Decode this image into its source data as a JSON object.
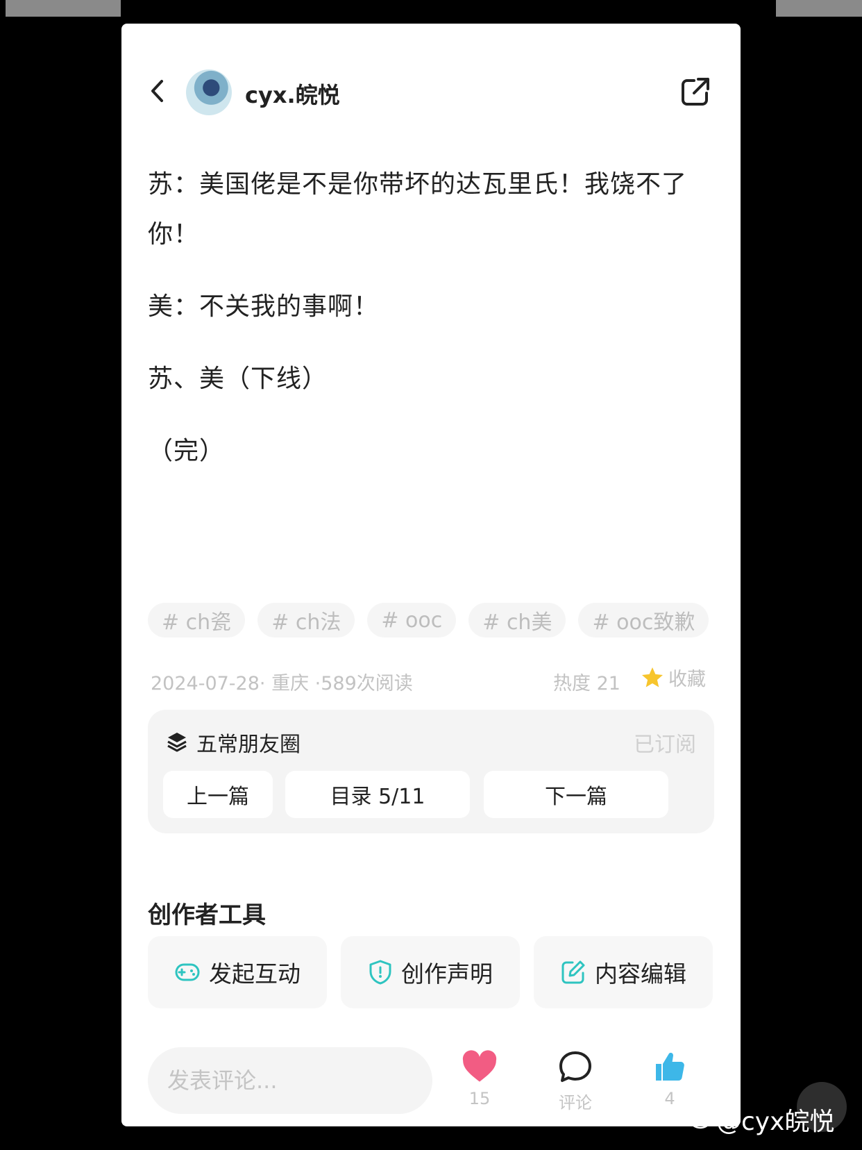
{
  "header": {
    "username": "cyx.皖悦",
    "back_icon": "chevron-left-icon",
    "share_icon": "external-share-icon"
  },
  "post": {
    "paragraphs": [
      "苏：美国佬是不是你带坏的达瓦里氏！我饶不了你！",
      "美：不关我的事啊！",
      "苏、美（下线）",
      "（完）"
    ],
    "tags": [
      "# ch瓷",
      "# ch法",
      "# ooc",
      "# ch美",
      "# ooc致歉"
    ],
    "meta": "2024-07-28· 重庆 ·589次阅读",
    "heat": "热度 21",
    "favorite_label": "收藏"
  },
  "collection": {
    "title": "五常朋友圈",
    "status": "已订阅",
    "prev_label": "上一篇",
    "toc_label": "目录 5/11",
    "next_label": "下一篇"
  },
  "creator_tools": {
    "title": "创作者工具",
    "items": [
      {
        "label": "发起互动",
        "icon": "gamepad-icon"
      },
      {
        "label": "创作声明",
        "icon": "shield-icon"
      },
      {
        "label": "内容编辑",
        "icon": "edit-icon"
      }
    ]
  },
  "bottom_bar": {
    "comment_placeholder": "发表评论...",
    "like_count": "15",
    "comment_label": "评论",
    "thumb_count": "4"
  },
  "watermark": "@cyx皖悦",
  "colors": {
    "accent": "#2ec4c0",
    "heart": "#f25c83",
    "thumb": "#3db7e8",
    "star": "#f7c52d"
  }
}
